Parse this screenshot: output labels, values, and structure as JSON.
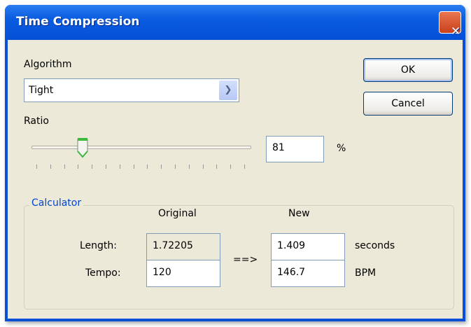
{
  "window": {
    "title": "Time Compression",
    "close_icon": "close-icon"
  },
  "algorithm": {
    "label": "Algorithm",
    "value": "Tight"
  },
  "buttons": {
    "ok": "OK",
    "cancel": "Cancel"
  },
  "ratio": {
    "label": "Ratio",
    "value": "81",
    "unit": "%"
  },
  "calculator": {
    "title": "Calculator",
    "col_original": "Original",
    "col_new": "New",
    "arrow": "==>",
    "rows": [
      {
        "label": "Length:",
        "original": "1.72205",
        "new": "1.409",
        "unit": "seconds"
      },
      {
        "label": "Tempo:",
        "original": "120",
        "new": "146.7",
        "unit": "BPM"
      }
    ]
  }
}
